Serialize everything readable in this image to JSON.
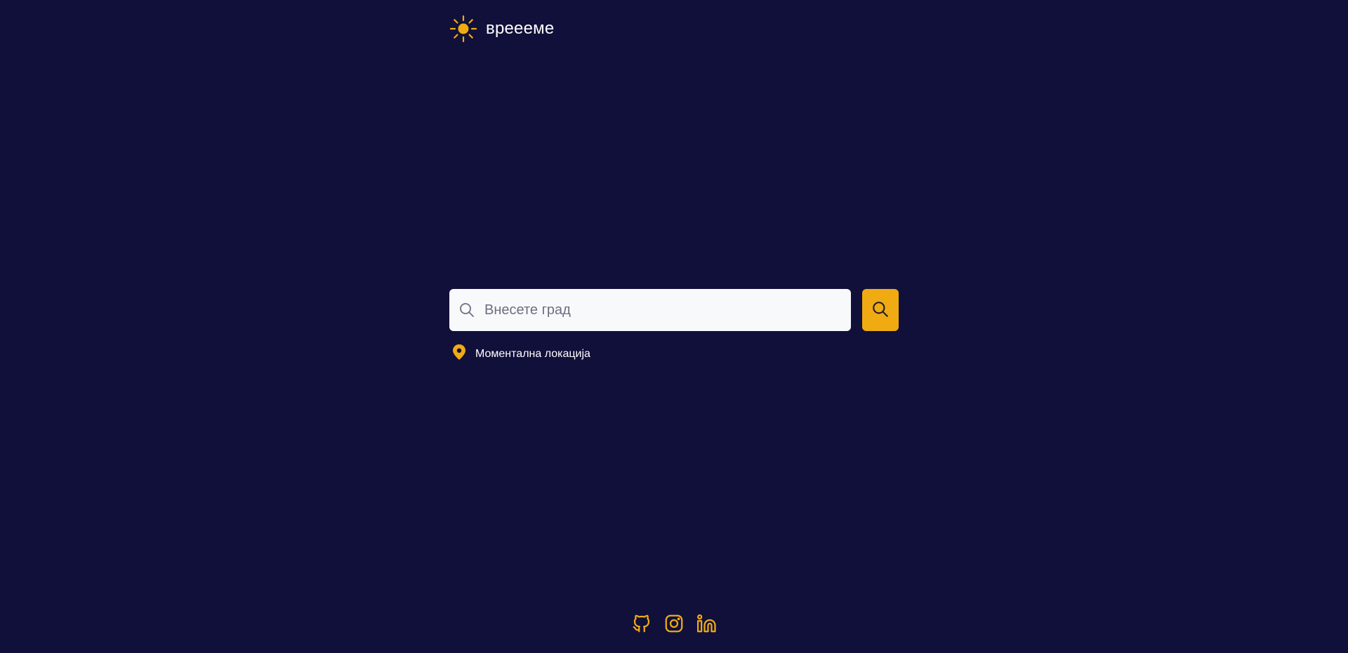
{
  "header": {
    "app_title": "вреееме",
    "logo_icon": "sun-icon"
  },
  "search": {
    "placeholder": "Внесете град",
    "value": "",
    "input_icon": "search-icon",
    "button_icon": "search-icon"
  },
  "location": {
    "label": "Моментална локација",
    "icon": "map-pin-icon"
  },
  "footer": {
    "links": [
      {
        "icon": "github-icon"
      },
      {
        "icon": "instagram-icon"
      },
      {
        "icon": "linkedin-icon"
      }
    ]
  },
  "colors": {
    "background": "#11103a",
    "accent": "#f0ab12",
    "input_background": "#f8f9fb",
    "text": "#ffffff"
  }
}
